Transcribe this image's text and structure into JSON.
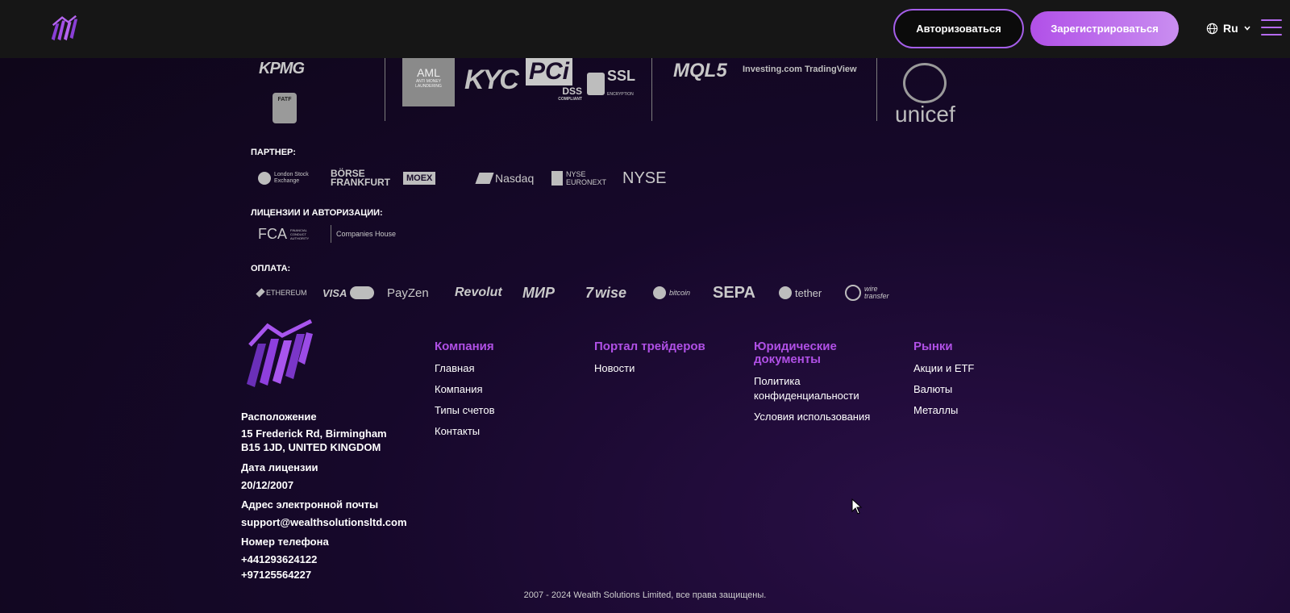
{
  "header": {
    "logo_icon": "bar-chart-logo",
    "login_label": "Авторизоваться",
    "register_label": "Зарегистрироваться",
    "language": "Ru",
    "globe_icon": "globe-icon",
    "menu_icon": "hamburger-icon",
    "accent": "#b150e8"
  },
  "trust_logos": {
    "kpmg": "KPMG",
    "fatf": "FATF",
    "aml": "AML",
    "aml_sub": "ANTI MONEY LAUNDERING",
    "kyc": "KYC",
    "pci": "PCi",
    "pci_sub": "DSS",
    "pci_sub2": "COMPLIANT",
    "ssl": "SSL",
    "ssl_sub": "ENCRYPTION",
    "mql": "MQL5",
    "investing": "Investing.com",
    "tradingview": "TradingView",
    "unicef": "unicef"
  },
  "partners": {
    "title": "ПАРТНЕР:",
    "lse": "London Stock Exchange",
    "borse": "BÖRSE FRANKFURT",
    "moex": "MOEX",
    "nasdaq": "Nasdaq",
    "euronext": "NYSE EURONEXT",
    "nyse": "NYSE"
  },
  "licenses": {
    "title": "ЛИЦЕНЗИИ И АВТОРИЗАЦИИ:",
    "fca": "FCA",
    "fca_sub": "FINANCIAL CONDUCT AUTHORITY",
    "companies_house": "Companies House"
  },
  "payments": {
    "title": "ОПЛАТА:",
    "ethereum": "ETHEREUM",
    "visa": "VISA",
    "payzen": "PayZen",
    "revolut": "Revolut",
    "mir": "МИР",
    "wise": "wise",
    "bitcoin": "bitcoin",
    "sepa": "SEPA",
    "tether": "tether",
    "wire": "wire transfer"
  },
  "info": {
    "location_label": "Расположение",
    "location_line1": "15 Frederick Rd, Birmingham",
    "location_line2": "B15 1JD, UNITED KINGDOM",
    "license_label": "Дата лицензии",
    "license_date": "20/12/2007",
    "email_label": "Адрес электронной почты",
    "email": "support@wealthsolutionsltd.com",
    "phone_label": "Номер телефона",
    "phone1": "+441293624122",
    "phone2": "+97125564227"
  },
  "columns": {
    "company": {
      "title": "Компания",
      "links": [
        "Главная",
        "Компания",
        "Типы счетов",
        "Контакты"
      ]
    },
    "traders": {
      "title": "Портал трейдеров",
      "links": [
        "Новости"
      ]
    },
    "legal": {
      "title_line1": "Юридические",
      "title_line2": "документы",
      "links_privacy1": "Политика",
      "links_privacy2": "конфиденциальности",
      "terms": "Условия использования"
    },
    "markets": {
      "title": "Рынки",
      "links": [
        "Акции и ETF",
        "Валюты",
        "Металлы"
      ]
    }
  },
  "copyright": "2007 - 2024 Wealth Solutions Limited, все права защищены."
}
